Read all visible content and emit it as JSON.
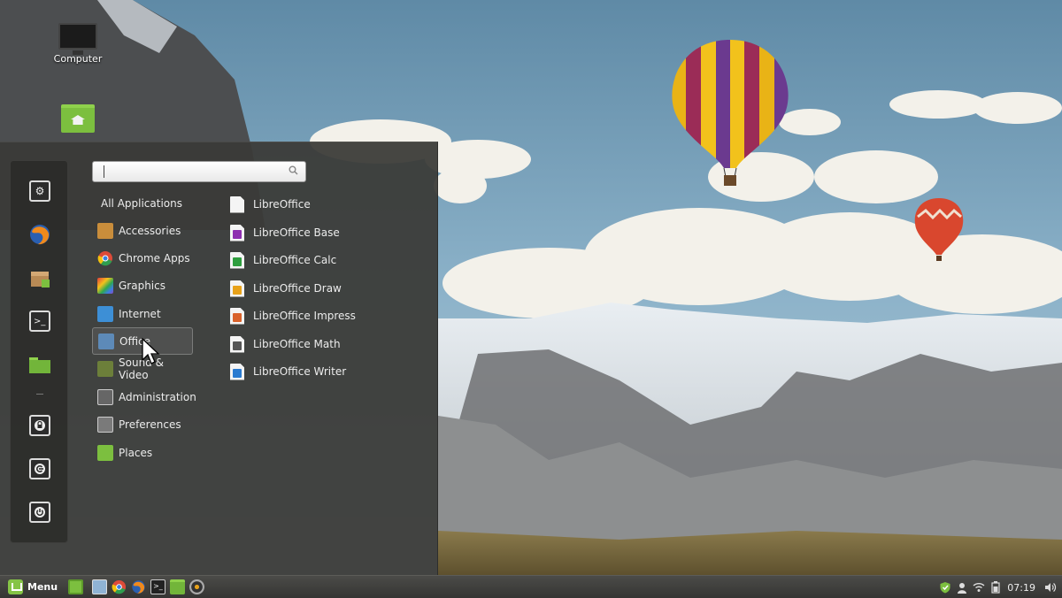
{
  "desktop": {
    "icons": [
      {
        "label": "Computer",
        "icon": "computer-icon"
      },
      {
        "label": "",
        "icon": "home-folder-icon"
      }
    ]
  },
  "menu": {
    "search": {
      "value": "",
      "placeholder": ""
    },
    "favorites": [
      {
        "icon": "system-settings-icon"
      },
      {
        "icon": "firefox-icon"
      },
      {
        "icon": "package-manager-icon"
      },
      {
        "icon": "terminal-icon"
      },
      {
        "icon": "folder-icon"
      },
      {
        "icon": "lock-screen-icon"
      },
      {
        "icon": "logout-icon"
      },
      {
        "icon": "power-icon"
      }
    ],
    "categories": [
      {
        "label": "All Applications",
        "icon": ""
      },
      {
        "label": "Accessories",
        "icon": "accessories-icon",
        "color": "#c98d3b"
      },
      {
        "label": "Chrome Apps",
        "icon": "chrome-icon",
        "color": "#dd4b39"
      },
      {
        "label": "Graphics",
        "icon": "graphics-icon",
        "color": "#8a46c4"
      },
      {
        "label": "Internet",
        "icon": "internet-icon",
        "color": "#3d8fd6"
      },
      {
        "label": "Office",
        "icon": "office-icon",
        "color": "#5d8ab8"
      },
      {
        "label": "Sound & Video",
        "icon": "sound-video-icon",
        "color": "#6c7f3a"
      },
      {
        "label": "Administration",
        "icon": "administration-icon",
        "color": "#666666"
      },
      {
        "label": "Preferences",
        "icon": "preferences-icon",
        "color": "#7a7a7a"
      },
      {
        "label": "Places",
        "icon": "places-icon",
        "color": "#7cbf3f"
      }
    ],
    "selected_category": "Office",
    "apps": [
      {
        "label": "LibreOffice",
        "icon": "libreoffice-icon",
        "color": ""
      },
      {
        "label": "LibreOffice Base",
        "icon": "libreoffice-base-icon",
        "color": "#8e2eb0"
      },
      {
        "label": "LibreOffice Calc",
        "icon": "libreoffice-calc-icon",
        "color": "#2f9e3f"
      },
      {
        "label": "LibreOffice Draw",
        "icon": "libreoffice-draw-icon",
        "color": "#e8a21a"
      },
      {
        "label": "LibreOffice Impress",
        "icon": "libreoffice-impress-icon",
        "color": "#d9622b"
      },
      {
        "label": "LibreOffice Math",
        "icon": "libreoffice-math-icon",
        "color": "#555555"
      },
      {
        "label": "LibreOffice Writer",
        "icon": "libreoffice-writer-icon",
        "color": "#2a7bd0"
      }
    ]
  },
  "taskbar": {
    "menu_label": "Menu",
    "launchers": [
      "show-desktop-icon",
      "file-manager-icon",
      "chrome-icon",
      "firefox-icon",
      "terminal-icon",
      "folder-icon",
      "software-icon"
    ],
    "tray": [
      "shield-icon",
      "user-icon",
      "network-icon",
      "battery-icon"
    ],
    "clock": "07:19",
    "volume_icon": "volume-icon"
  }
}
